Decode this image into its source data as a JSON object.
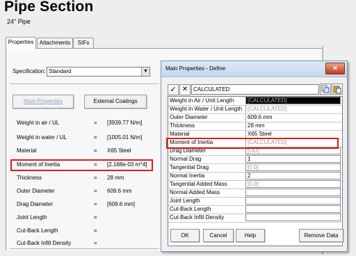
{
  "header": {
    "title": "Pipe Section",
    "subtitle": "24\" Pipe"
  },
  "tabs": [
    {
      "label": "Properties"
    },
    {
      "label": "Attachments"
    },
    {
      "label": "SIFs"
    }
  ],
  "specification": {
    "label": "Specification:",
    "value": "Standard",
    "arrow": "▼"
  },
  "buttons": {
    "main_properties": "Main Properties",
    "external_coatings": "External Coatings"
  },
  "properties": [
    {
      "label": "Weight in air / UL",
      "value": "[3939.77 N/m]"
    },
    {
      "label": "Weight in water / UL",
      "value": "[1005.01 N/m]"
    },
    {
      "label": "Material",
      "value": "X65 Steel"
    },
    {
      "label": "Moment of Inertia",
      "value": "[2.168e-03 m^4]"
    },
    {
      "label": "Thickness",
      "value": "28 mm"
    },
    {
      "label": "Outer Diameter",
      "value": "609.6 mm"
    },
    {
      "label": "Drag Diameter",
      "value": "[609.6 mm]"
    },
    {
      "label": "Joint Length",
      "value": ""
    },
    {
      "label": "Cut-Back Length",
      "value": ""
    },
    {
      "label": "Cut-Back Infill Density",
      "value": ""
    }
  ],
  "equals": "=",
  "dialog": {
    "title": "Main Properties - Define",
    "close": "✕",
    "check": "✓",
    "cancel_x": "✕",
    "input_value": "CALCULATED",
    "rows": [
      {
        "label": "Weight in Air / Unit Length",
        "value": "[CALCULATED]"
      },
      {
        "label": "Weight in Water / Unit Length",
        "value": "[CALCULATED]"
      },
      {
        "label": "Outer Diameter",
        "value": "609.6 mm"
      },
      {
        "label": "Thickness",
        "value": "28 mm"
      },
      {
        "label": "Material",
        "value": "X65 Steel"
      },
      {
        "label": "Moment of Inertia",
        "value": "[CALCULATED]"
      },
      {
        "label": "Drag Diameter",
        "value": "[OD]"
      },
      {
        "label": "Normal Drag",
        "value": "1"
      },
      {
        "label": "Tangential Drag",
        "value": "[0.0]"
      },
      {
        "label": "Normal Inertia",
        "value": "2"
      },
      {
        "label": "Tangential Added Mass",
        "value": "[0.0]"
      },
      {
        "label": "Normal Added Mass",
        "value": ""
      },
      {
        "label": "Joint Length",
        "value": ""
      },
      {
        "label": "Cut-Back Length",
        "value": ""
      },
      {
        "label": "Cut-Back Infill Density",
        "value": ""
      }
    ],
    "buttons": {
      "ok": "OK",
      "cancel": "Cancel",
      "help": "Help",
      "remove": "Remove Data"
    }
  },
  "colors": {
    "highlight": "#e01b1b",
    "titlebar": "#c6d8ef",
    "close": "#c43b1e"
  }
}
